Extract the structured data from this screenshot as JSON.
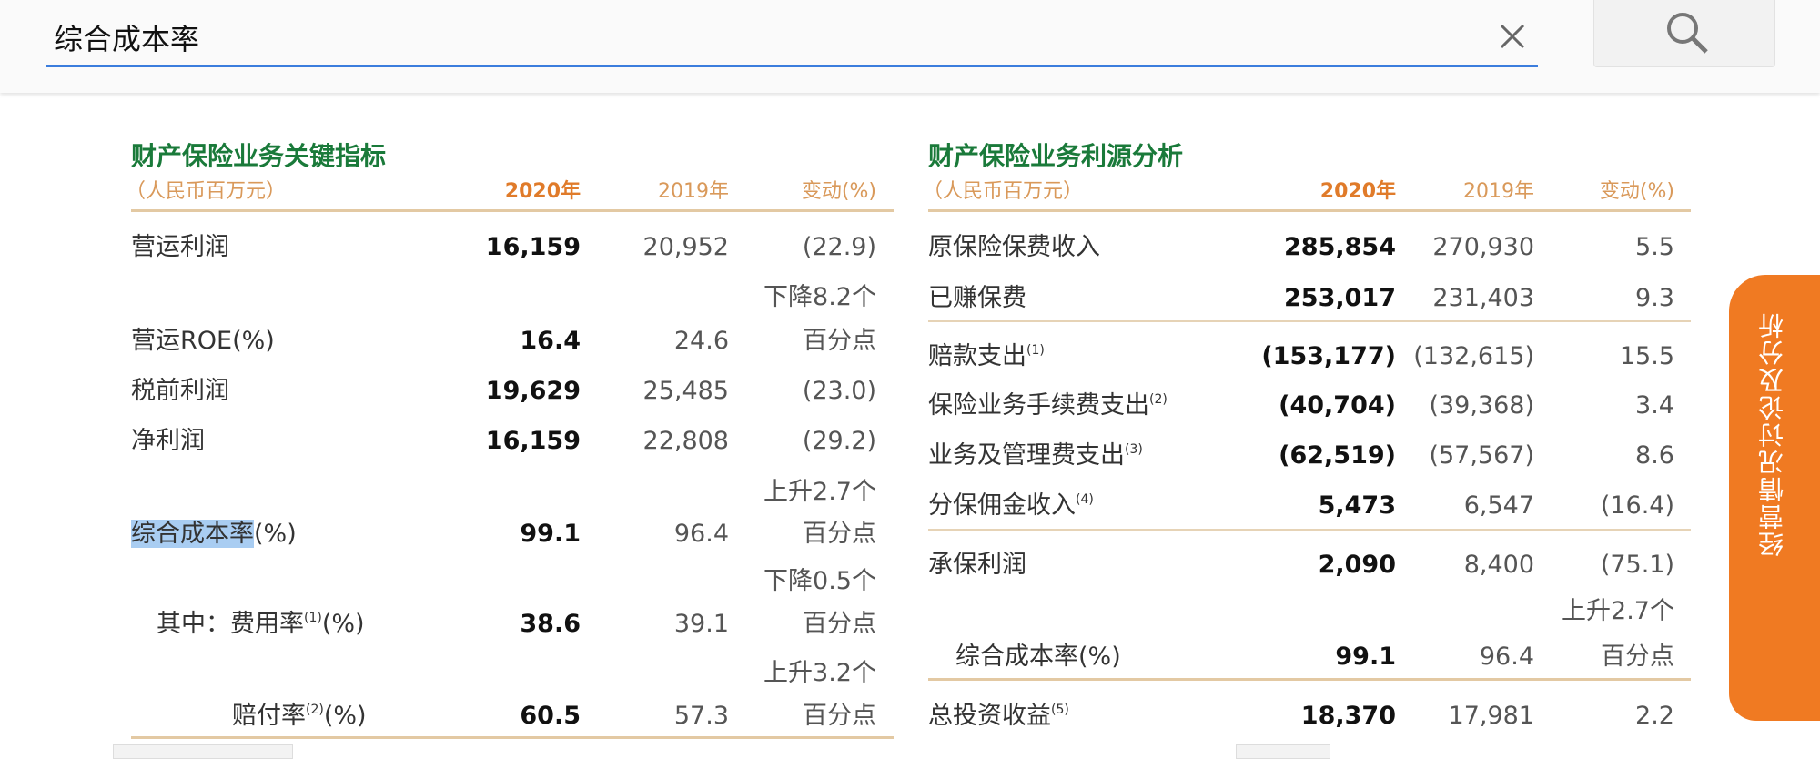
{
  "search": {
    "value": "综合成本率",
    "clear_icon": "close-icon",
    "search_icon": "search-icon"
  },
  "left": {
    "title": "财产保险业务关键指标",
    "unit": "（人民币百万元）",
    "col2020": "2020年",
    "col2019": "2019年",
    "colchg": "变动(%)",
    "rows": [
      {
        "label": "营运利润",
        "v2020": "16,159",
        "v2019": "20,952",
        "chg": "(22.9)"
      },
      {
        "label": "营运ROE(%)",
        "v2020": "16.4",
        "v2019": "24.6",
        "chg1": "下降8.2个",
        "chg2": "百分点"
      },
      {
        "label": "税前利润",
        "v2020": "19,629",
        "v2019": "25,485",
        "chg": "(23.0)"
      },
      {
        "label": "净利润",
        "v2020": "16,159",
        "v2019": "22,808",
        "chg": "(29.2)"
      },
      {
        "label_hl": "综合成本率",
        "label_rest": "(%)",
        "v2020": "99.1",
        "v2019": "96.4",
        "chg1": "上升2.7个",
        "chg2": "百分点"
      },
      {
        "label": "其中：费用率",
        "sup": "(1)",
        "suffix": "(%)",
        "v2020": "38.6",
        "v2019": "39.1",
        "chg1": "下降0.5个",
        "chg2": "百分点"
      },
      {
        "label": "赔付率",
        "sup": "(2)",
        "suffix": "(%)",
        "v2020": "60.5",
        "v2019": "57.3",
        "chg1": "上升3.2个",
        "chg2": "百分点"
      }
    ]
  },
  "right": {
    "title": "财产保险业务利源分析",
    "unit": "（人民币百万元）",
    "col2020": "2020年",
    "col2019": "2019年",
    "colchg": "变动(%)",
    "rows": [
      {
        "label": "原保险保费收入",
        "v2020": "285,854",
        "v2019": "270,930",
        "chg": "5.5"
      },
      {
        "label": "已赚保费",
        "v2020": "253,017",
        "v2019": "231,403",
        "chg": "9.3"
      },
      {
        "label": "赔款支出",
        "sup": "(1)",
        "v2020": "(153,177)",
        "v2019": "(132,615)",
        "chg": "15.5"
      },
      {
        "label": "保险业务手续费支出",
        "sup": "(2)",
        "v2020": "(40,704)",
        "v2019": "(39,368)",
        "chg": "3.4"
      },
      {
        "label": "业务及管理费支出",
        "sup": "(3)",
        "v2020": "(62,519)",
        "v2019": "(57,567)",
        "chg": "8.6"
      },
      {
        "label": "分保佣金收入",
        "sup": "(4)",
        "v2020": "5,473",
        "v2019": "6,547",
        "chg": "(16.4)"
      },
      {
        "label": "承保利润",
        "v2020": "2,090",
        "v2019": "8,400",
        "chg": "(75.1)"
      },
      {
        "label": "综合成本率(%)",
        "v2020": "99.1",
        "v2019": "96.4",
        "chg1": "上升2.7个",
        "chg2": "百分点"
      },
      {
        "label": "总投资收益",
        "sup": "(5)",
        "v2020": "18,370",
        "v2019": "17,981",
        "chg": "2.2"
      }
    ]
  },
  "side_tab": {
    "label": "经营情况讨论及分析"
  }
}
